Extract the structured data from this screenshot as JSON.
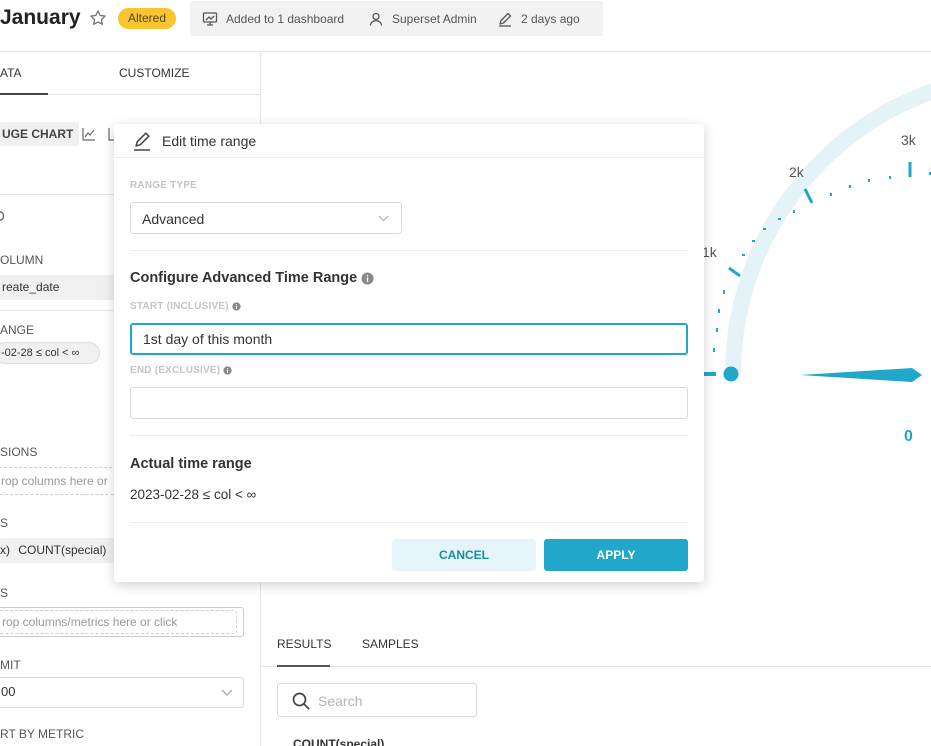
{
  "header": {
    "title": "January",
    "badge": "Altered",
    "meta": {
      "dashboards": "Added to 1 dashboard",
      "owner": "Superset Admin",
      "modified": "2 days ago"
    }
  },
  "left_panel": {
    "tabs": [
      {
        "label": "ATA"
      },
      {
        "label": "CUSTOMIZE"
      }
    ],
    "chart_type_label": "UGE CHART",
    "temporal_column_label": "OLUMN",
    "temporal_column_value": "reate_date",
    "time_range_label": "ANGE",
    "time_range_value": "-02-28 ≤ col < ∞",
    "dimensions_label": "SIONS",
    "dimensions_placeholder": "rop columns here or",
    "metric_label": "S",
    "metric_prefix": "x)",
    "metric_value": "COUNT(special)",
    "filters_label": "S",
    "filters_placeholder": "rop columns/metrics here or click",
    "row_limit_label": "MIT",
    "row_limit_value": "00",
    "sort_label": "RT BY METRIC"
  },
  "gauge": {
    "tick_labels": [
      "1k",
      "2k",
      "3k"
    ],
    "value": "0"
  },
  "results": {
    "tabs": [
      {
        "label": "RESULTS"
      },
      {
        "label": "SAMPLES"
      }
    ],
    "search_placeholder": "Search",
    "column_header": "COUNT(special)"
  },
  "modal": {
    "title": "Edit time range",
    "range_type_label": "RANGE TYPE",
    "range_type_value": "Advanced",
    "configure_heading": "Configure Advanced Time Range",
    "start_label": "START (INCLUSIVE)",
    "start_value": "1st day of this month",
    "end_label": "END (EXCLUSIVE)",
    "end_value": "",
    "actual_heading": "Actual time range",
    "actual_value": "2023-02-28 ≤ col < ∞",
    "cancel_label": "CANCEL",
    "apply_label": "APPLY"
  },
  "colors": {
    "accent": "#20a7c9",
    "badge": "#f8c530"
  }
}
